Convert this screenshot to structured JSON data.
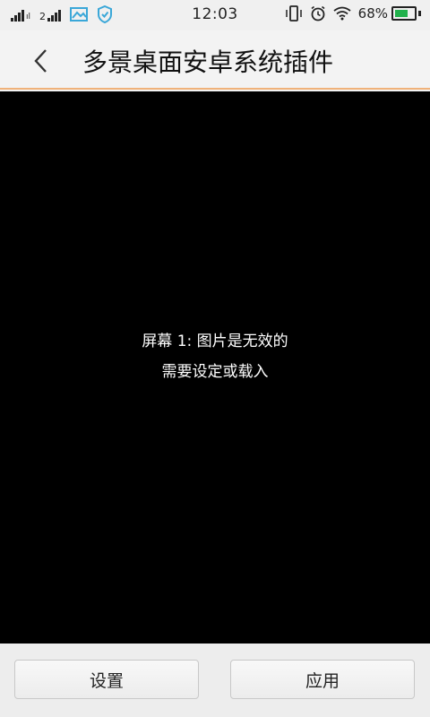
{
  "status_bar": {
    "time": "12:03",
    "battery_text": "68%",
    "battery_level": 0.68,
    "battery_color": "#22b14c",
    "icons_left": [
      "signal-icon",
      "signal-2g-icon",
      "gallery-icon",
      "shield-icon"
    ],
    "icons_right": [
      "vibrate-icon",
      "alarm-icon",
      "wifi-icon",
      "battery-icon"
    ]
  },
  "header": {
    "title": "多景桌面安卓系统插件",
    "back_icon": "chevron-left-icon",
    "accent_color": "#f0b27a"
  },
  "preview": {
    "line1": "屏幕 1: 图片是无效的",
    "line2": "需要设定或载入"
  },
  "actions": {
    "settings_label": "设置",
    "apply_label": "应用"
  }
}
